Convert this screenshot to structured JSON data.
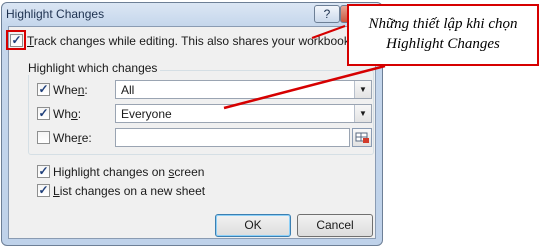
{
  "dialog": {
    "title": "Highlight Changes",
    "help_label": "?",
    "close_label": "✕",
    "track_changes": {
      "checked": true,
      "mark": "✓",
      "label_accel": "T",
      "label_rest": "rack changes while editing. This also shares your workbook."
    },
    "group_title": "Highlight which changes",
    "when": {
      "checked": true,
      "mark": "✓",
      "accel": "n",
      "before": "Whe",
      "after": ":",
      "value": "All"
    },
    "who": {
      "checked": true,
      "mark": "✓",
      "accel": "o",
      "before": "Wh",
      "after": ":",
      "value": "Everyone"
    },
    "where": {
      "checked": false,
      "before": "Whe",
      "accel": "r",
      "after": "e:",
      "value": ""
    },
    "highlight_on_screen": {
      "checked": true,
      "mark": "✓",
      "before": "Highlight changes on ",
      "accel": "s",
      "after": "creen"
    },
    "list_on_sheet": {
      "checked": true,
      "mark": "✓",
      "accel": "L",
      "after": "ist changes on a new sheet"
    },
    "ok_label": "OK",
    "cancel_label": "Cancel",
    "dropdown_arrow": "▼"
  },
  "annotation": {
    "line1": "Những thiết lập khi chọn",
    "line2": "Highlight Changes",
    "color": "#d60000"
  },
  "icons": {
    "where_picker": "range-picker-icon"
  }
}
